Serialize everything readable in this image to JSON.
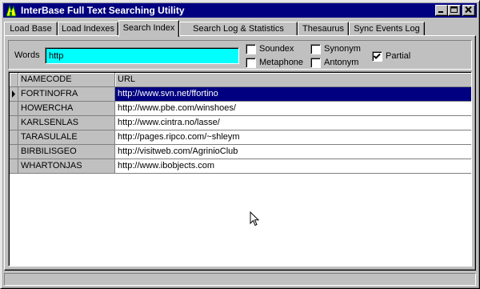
{
  "window": {
    "title": "InterBase Full Text Searching Utility",
    "title_bar_color": "#000080"
  },
  "tabs": [
    {
      "label": "Load Base"
    },
    {
      "label": "Load Indexes"
    },
    {
      "label": "Search Index",
      "active": true
    },
    {
      "label": "Search Log & Statistics"
    },
    {
      "label": "Thesaurus"
    },
    {
      "label": "Sync Events Log"
    }
  ],
  "search": {
    "words_label": "Words",
    "words_value": "http",
    "input_color": "#00ffff",
    "options": {
      "soundex": {
        "label": "Soundex",
        "checked": false
      },
      "metaphone": {
        "label": "Metaphone",
        "checked": false
      },
      "synonym": {
        "label": "Synonym",
        "checked": false
      },
      "antonym": {
        "label": "Antonym",
        "checked": false
      },
      "partial": {
        "label": "Partial",
        "checked": true
      }
    }
  },
  "grid": {
    "columns": [
      "NAMECODE",
      "URL"
    ],
    "rows": [
      {
        "namecode": "FORTINOFRA",
        "url": "http://www.svn.net/ffortino",
        "selected": true
      },
      {
        "namecode": "HOWERCHA",
        "url": "http://www.pbe.com/winshoes/"
      },
      {
        "namecode": "KARLSENLAS",
        "url": "http://www.cintra.no/lasse/"
      },
      {
        "namecode": "TARASULALE",
        "url": "http://pages.ripco.com/~shleym"
      },
      {
        "namecode": "BIRBILISGEO",
        "url": "http://visitweb.com/AgrinioClub"
      },
      {
        "namecode": "WHARTONJAS",
        "url": "http://www.ibobjects.com"
      }
    ],
    "selection_color": "#000080"
  }
}
